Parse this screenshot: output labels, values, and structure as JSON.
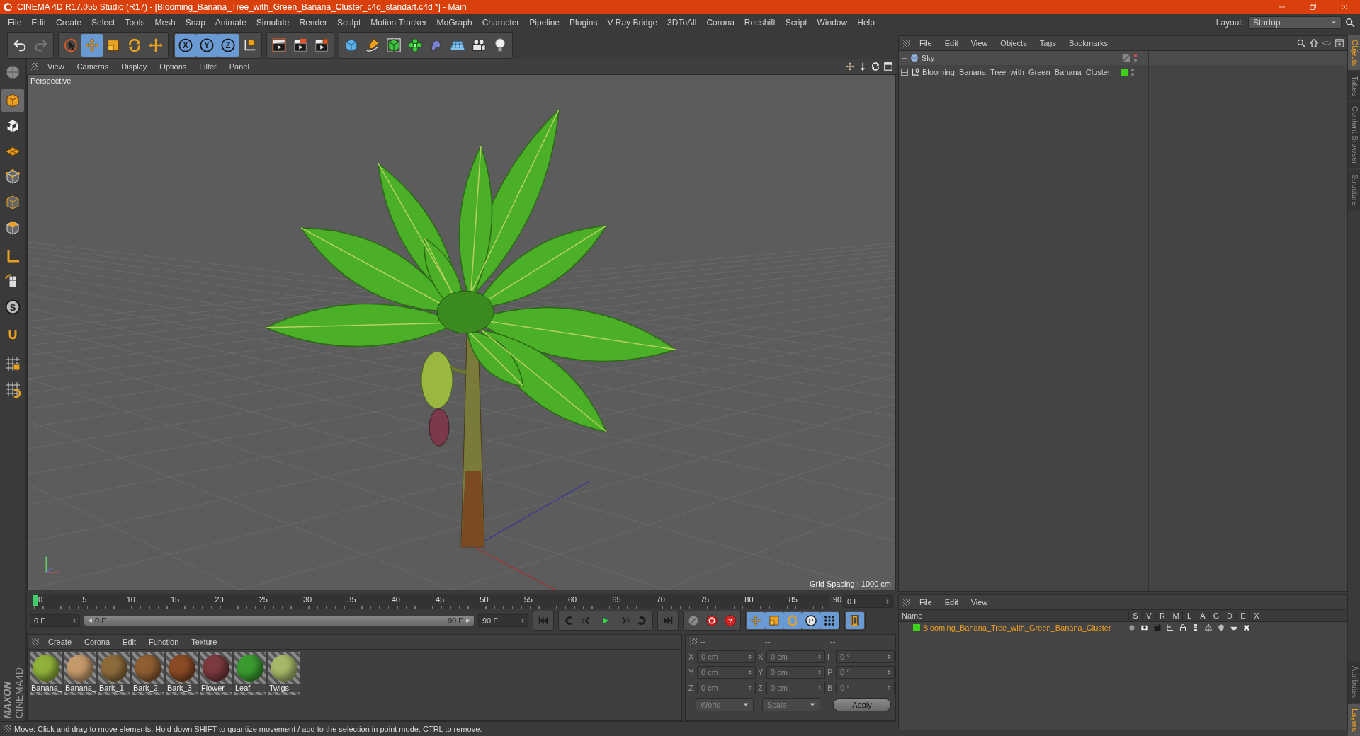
{
  "window": {
    "title": "CINEMA 4D R17.055 Studio (R17) - [Blooming_Banana_Tree_with_Green_Banana_Cluster_c4d_standart.c4d *] - Main"
  },
  "menu_bar": [
    "File",
    "Edit",
    "Create",
    "Select",
    "Tools",
    "Mesh",
    "Snap",
    "Animate",
    "Simulate",
    "Render",
    "Sculpt",
    "Motion Tracker",
    "MoGraph",
    "Character",
    "Pipeline",
    "Plugins",
    "V-Ray Bridge",
    "3DToAll",
    "Corona",
    "Redshift",
    "Script",
    "Window",
    "Help"
  ],
  "layout": {
    "label": "Layout:",
    "value": "Startup"
  },
  "toolbar": [
    [
      {
        "kind": "undo",
        "selected": false
      },
      {
        "kind": "redo",
        "selected": false
      }
    ],
    [
      {
        "kind": "cursor",
        "selected": false
      },
      {
        "kind": "move",
        "selected": true
      },
      {
        "kind": "scale",
        "selected": false
      },
      {
        "kind": "rotate",
        "selected": false
      },
      {
        "kind": "axis",
        "selected": false
      }
    ],
    [
      {
        "kind": "lettered",
        "label": "X",
        "selected": true
      },
      {
        "kind": "lettered",
        "label": "Y",
        "selected": true
      },
      {
        "kind": "lettered",
        "label": "Z",
        "selected": true
      },
      {
        "kind": "coord",
        "selected": false
      }
    ],
    [
      {
        "kind": "renderview",
        "selected": false
      },
      {
        "kind": "render",
        "selected": false
      },
      {
        "kind": "rendersettings",
        "selected": false
      }
    ],
    [
      {
        "kind": "cube",
        "selected": false
      },
      {
        "kind": "pen",
        "selected": false
      },
      {
        "kind": "subdiv",
        "selected": false
      },
      {
        "kind": "cloner",
        "selected": false
      },
      {
        "kind": "deformer",
        "selected": false
      },
      {
        "kind": "floor",
        "selected": false
      },
      {
        "kind": "camera",
        "selected": false
      },
      {
        "kind": "light",
        "selected": false
      }
    ]
  ],
  "left_toolbar": [
    [
      {
        "kind": "editable",
        "selected": false
      }
    ],
    [
      {
        "kind": "model",
        "selected": true
      },
      {
        "kind": "texture",
        "selected": false
      },
      {
        "kind": "workplane",
        "selected": false
      },
      {
        "kind": "points",
        "selected": false
      },
      {
        "kind": "edges",
        "selected": false
      },
      {
        "kind": "polygons",
        "selected": false
      }
    ],
    [
      {
        "kind": "laxis",
        "selected": false
      },
      {
        "kind": "tweak",
        "selected": false
      },
      {
        "kind": "lettered",
        "label": "S",
        "selected": false
      }
    ],
    [
      {
        "kind": "magnet",
        "selected": false
      }
    ],
    [
      {
        "kind": "lockgrid",
        "selected": false
      },
      {
        "kind": "gridrot",
        "selected": false
      }
    ]
  ],
  "viewport": {
    "menu": [
      "View",
      "Cameras",
      "Display",
      "Options",
      "Filter",
      "Panel"
    ],
    "camera": "Perspective",
    "grid_spacing": "Grid Spacing : 1000 cm"
  },
  "timeline": {
    "ticks": [
      "0",
      "5",
      "10",
      "15",
      "20",
      "25",
      "30",
      "35",
      "40",
      "45",
      "50",
      "55",
      "60",
      "65",
      "70",
      "75",
      "80",
      "85",
      "90"
    ],
    "level": 0,
    "current_frame": "0 F",
    "start_field": "0 F",
    "range": {
      "level": 1
    },
    "range_start": "0 F",
    "range_end": "90 F",
    "end_field": "90 F"
  },
  "transport": [
    [
      {
        "kind": "start",
        "selected": false
      }
    ],
    [
      {
        "kind": "prevkey",
        "selected": false
      },
      {
        "kind": "prevframe",
        "selected": false
      },
      {
        "kind": "play",
        "selected": false
      },
      {
        "kind": "nextframe",
        "selected": false
      },
      {
        "kind": "nextkey",
        "selected": false
      }
    ],
    [
      {
        "kind": "end",
        "selected": false
      }
    ],
    [
      {
        "kind": "keyoff",
        "selected": false
      },
      {
        "kind": "record",
        "selected": false
      },
      {
        "kind": "help",
        "label": "?",
        "selected": false
      }
    ],
    [
      {
        "kind": "move",
        "selected": true
      },
      {
        "kind": "scale",
        "selected": true
      },
      {
        "kind": "rotate",
        "selected": true
      },
      {
        "kind": "lettered",
        "label": "P",
        "selected": true
      },
      {
        "kind": "dots",
        "selected": true
      }
    ],
    [
      {
        "kind": "film",
        "selected": true
      }
    ]
  ],
  "material_manager": {
    "menu": [
      "Create",
      "Corona",
      "Edit",
      "Function",
      "Texture"
    ],
    "materials": [
      {
        "name": "Banana_",
        "color": "#8fb13a"
      },
      {
        "name": "Banana_",
        "color": "#c49a6c"
      },
      {
        "name": "Bark_1",
        "color": "#8c6a3a"
      },
      {
        "name": "Bark_2",
        "color": "#8e5e30"
      },
      {
        "name": "Bark_3",
        "color": "#8a4a25"
      },
      {
        "name": "Flower",
        "color": "#7a3a3e"
      },
      {
        "name": "Leaf",
        "color": "#3a9a30"
      },
      {
        "name": "Twigs",
        "color": "#a6b868"
      }
    ]
  },
  "coordinates": {
    "headers": [
      "--",
      "--",
      "--"
    ],
    "rows": [
      {
        "axis": "X",
        "position": "0 cm",
        "size_axis": "X",
        "size": "0 cm",
        "rotation_axis": "H",
        "rotation": "0 °"
      },
      {
        "axis": "Y",
        "position": "0 cm",
        "size_axis": "Y",
        "size": "0 cm",
        "rotation_axis": "P",
        "rotation": "0 °"
      },
      {
        "axis": "Z",
        "position": "0 cm",
        "size_axis": "Z",
        "size": "0 cm",
        "rotation_axis": "B",
        "rotation": "0 °"
      }
    ],
    "space": "World",
    "mode": "Scale",
    "apply": "Apply"
  },
  "object_manager": {
    "menu": [
      "File",
      "Edit",
      "View",
      "Objects",
      "Tags",
      "Bookmarks"
    ],
    "objects": [
      {
        "name": "Sky",
        "kind": "sky"
      },
      {
        "name": "Blooming_Banana_Tree_with_Green_Banana_Cluster",
        "kind": "null",
        "color": "#3fcf1a"
      }
    ]
  },
  "layer_manager": {
    "menu": [
      "File",
      "Edit",
      "View"
    ],
    "columns": [
      "Name",
      "S",
      "V",
      "R",
      "M",
      "L",
      "A",
      "G",
      "D",
      "E",
      "X"
    ],
    "layers": [
      {
        "name": "Blooming_Banana_Tree_with_Green_Banana_Cluster",
        "color": "#3fcf1a"
      }
    ]
  },
  "side_tabs_top": [
    {
      "label": "Objects",
      "selected": true
    },
    {
      "label": "Takes",
      "selected": false
    },
    {
      "label": "Content Browser",
      "selected": false
    },
    {
      "label": "Structure",
      "selected": false
    }
  ],
  "side_tabs_bottom": [
    {
      "label": "Attributes",
      "selected": false
    },
    {
      "label": "Layers",
      "selected": true
    }
  ],
  "logo": {
    "brand": "MAXON",
    "product": "CINEMA4D"
  },
  "status_bar": "Move: Click and drag to move elements. Hold down SHIFT to quantize movement / add to the selection in point mode, CTRL to remove."
}
